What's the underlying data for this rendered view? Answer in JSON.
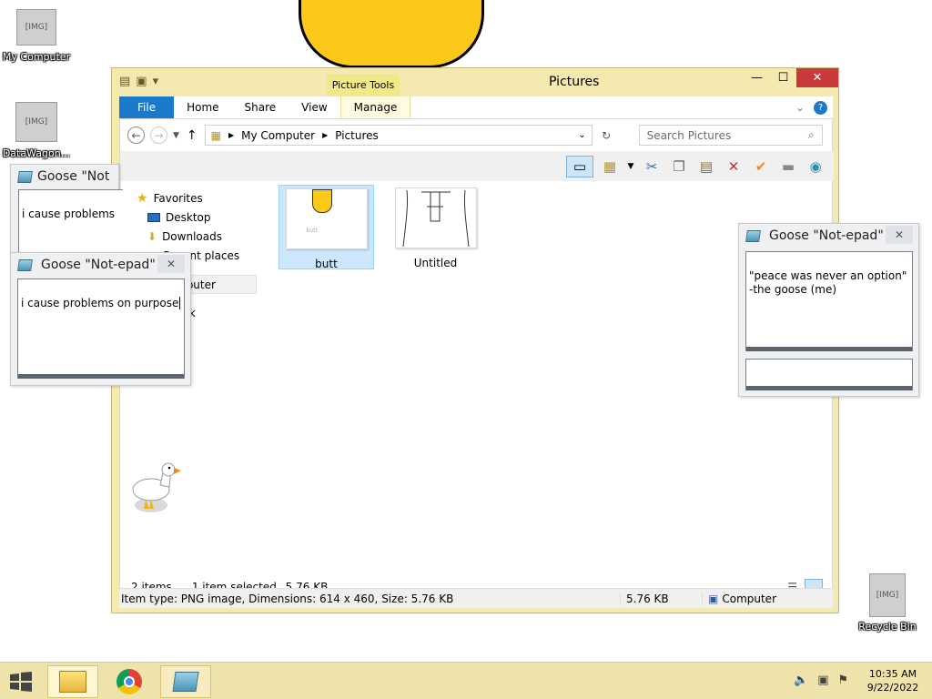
{
  "desktop": {
    "my_computer": "My Computer",
    "datawagon": "DataWagon...",
    "recycle_bin": "Recycle Bin"
  },
  "explorer": {
    "title": "Pictures",
    "context_tab_group": "Picture Tools",
    "tabs": {
      "file": "File",
      "home": "Home",
      "share": "Share",
      "view": "View",
      "manage": "Manage"
    },
    "address": {
      "seg1": "My Computer",
      "seg2": "Pictures"
    },
    "search_placeholder": "Search Pictures",
    "nav": {
      "favorites": "Favorites",
      "desktop": "Desktop",
      "downloads": "Downloads",
      "recent_places": "Recent places",
      "computer_fragment": "mputer",
      "network_fragment": "k"
    },
    "files": [
      {
        "name": "butt",
        "thumb_text": "butt",
        "selected": true
      },
      {
        "name": "Untitled",
        "selected": false
      }
    ],
    "status": {
      "items": "2 items",
      "selected": "1 item selected",
      "size": "5.76 KB"
    },
    "details": {
      "info": "Item type: PNG image, Dimensions: 614 x 460, Size: 5.76 KB",
      "size": "5.76 KB",
      "location": "Computer"
    }
  },
  "notes": [
    {
      "title": "Goose \"Not-epad\"",
      "text": "i cause problems"
    },
    {
      "title": "Goose \"Not-epad\"",
      "text": "i cause problems on purpose"
    },
    {
      "title": "Goose \"Not-epad\"",
      "text": "\"peace was never an option\"\n   -the goose (me)"
    }
  ],
  "note_title_partial": "Goose \"Not",
  "taskbar": {
    "time": "10:35 AM",
    "date": "9/22/2022"
  },
  "colors": {
    "accent": "#1979ca",
    "window_frame": "#f5e9b2",
    "close_red": "#c7393b",
    "goose_yellow": "#fcc81a"
  }
}
